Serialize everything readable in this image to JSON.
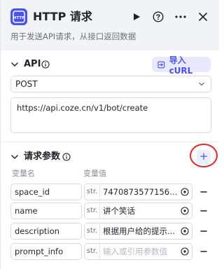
{
  "header": {
    "title": "HTTP 请求",
    "logo_text": "HTTP",
    "description": "用于发送API请求，从接口返回数据",
    "icons": [
      "play-icon",
      "help-icon",
      "more-icon",
      "close-icon"
    ]
  },
  "api_section": {
    "title": "API",
    "import_label": "导入 cURL",
    "method": "POST",
    "url": "https://api.coze.cn/v1/bot/create"
  },
  "params_section": {
    "title": "请求参数",
    "add_label": "+",
    "col_name": "变量名",
    "col_value": "变量值",
    "rows": [
      {
        "name": "space_id",
        "type": "str.",
        "value": "747087357715644...",
        "placeholder": false
      },
      {
        "name": "name",
        "type": "str.",
        "value": "讲个笑话",
        "placeholder": false
      },
      {
        "name": "description",
        "type": "str.",
        "value": "根据用户给的提示...",
        "placeholder": false
      },
      {
        "name": "prompt_info",
        "type": "str.",
        "value": "输入或引用参数值",
        "placeholder": true
      }
    ]
  },
  "colors": {
    "accent": "#4d53e8",
    "highlight": "#e02424",
    "header_bg": "#f2f3f7"
  }
}
